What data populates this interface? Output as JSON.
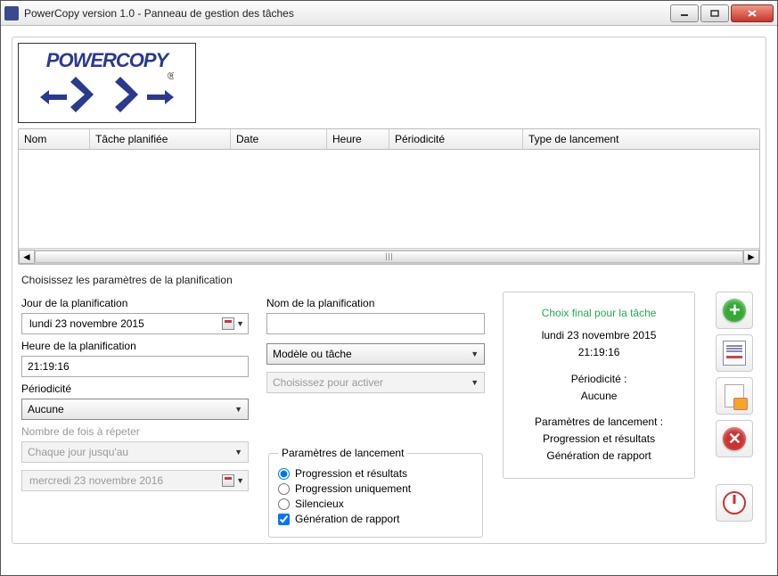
{
  "window": {
    "title": "PowerCopy version 1.0 - Panneau de gestion des tâches"
  },
  "logo": {
    "brand": "POWERCOPY"
  },
  "grid": {
    "columns": [
      "Nom",
      "Tâche planifiée",
      "Date",
      "Heure",
      "Périodicité",
      "Type de lancement"
    ],
    "rows": []
  },
  "section_title": "Choisissez les paramètres de la planification",
  "col1": {
    "day_label": "Jour de la planification",
    "date_value": "lundi   23 novembre 2015",
    "time_label": "Heure de la planification",
    "time_value": "21:19:16",
    "periodicity_label": "Périodicité",
    "periodicity_value": "Aucune",
    "repeat_label": "Nombre de fois à répeter",
    "repeat_value": "Chaque jour jusqu'au",
    "until_value": "mercredi 23 novembre 2016"
  },
  "col2": {
    "name_label": "Nom de la planification",
    "name_value": "",
    "model_value": "Modèle ou tâche",
    "activate_value": "Choisissez pour activer",
    "launch_legend": "Paramètres de lancement",
    "opt_progress_results": "Progression et résultats",
    "opt_progress_only": "Progression uniquement",
    "opt_silent": "Silencieux",
    "opt_report": "Génération de rapport",
    "selected_radio": "opt_progress_results",
    "report_checked": true
  },
  "summary": {
    "head": "Choix final pour la tâche",
    "date": "lundi 23 novembre 2015",
    "time": "21:19:16",
    "periodicity_label": "Périodicité :",
    "periodicity_value": "Aucune",
    "launch_label": "Paramètres de lancement :",
    "launch_l1": "Progression et résultats",
    "launch_l2": "Génération de rapport"
  }
}
